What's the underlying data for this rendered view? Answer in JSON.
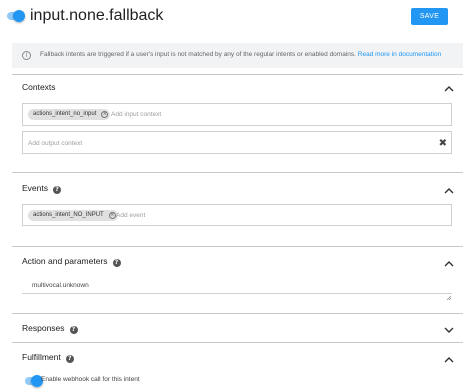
{
  "header": {
    "title": "input.none.fallback",
    "save_label": "SAVE",
    "enabled": true
  },
  "info": {
    "text": "Fallback intents are triggered if a user's input is not matched by any of the regular intents or enabled domains.",
    "link": "Read more in documentation"
  },
  "contexts": {
    "title": "Contexts",
    "input_chips": [
      "actions_intent_no_input"
    ],
    "input_placeholder": "Add input context",
    "output_placeholder": "Add output context"
  },
  "events": {
    "title": "Events",
    "chips": [
      "actions_intent_NO_INPUT"
    ],
    "placeholder": "Add event"
  },
  "action": {
    "title": "Action and parameters",
    "value": "multivocal.unknown"
  },
  "responses": {
    "title": "Responses"
  },
  "fulfillment": {
    "title": "Fulfillment",
    "webhook_label": "Enable webhook call for this intent",
    "webhook_enabled": true
  },
  "colors": {
    "accent": "#2196f3",
    "info_bg": "#f1f3f4"
  },
  "icons": {
    "help": "help-circle-icon",
    "collapse": "chevron-up-icon",
    "expand": "chevron-down-icon",
    "info": "info-icon",
    "clear": "close-icon"
  }
}
